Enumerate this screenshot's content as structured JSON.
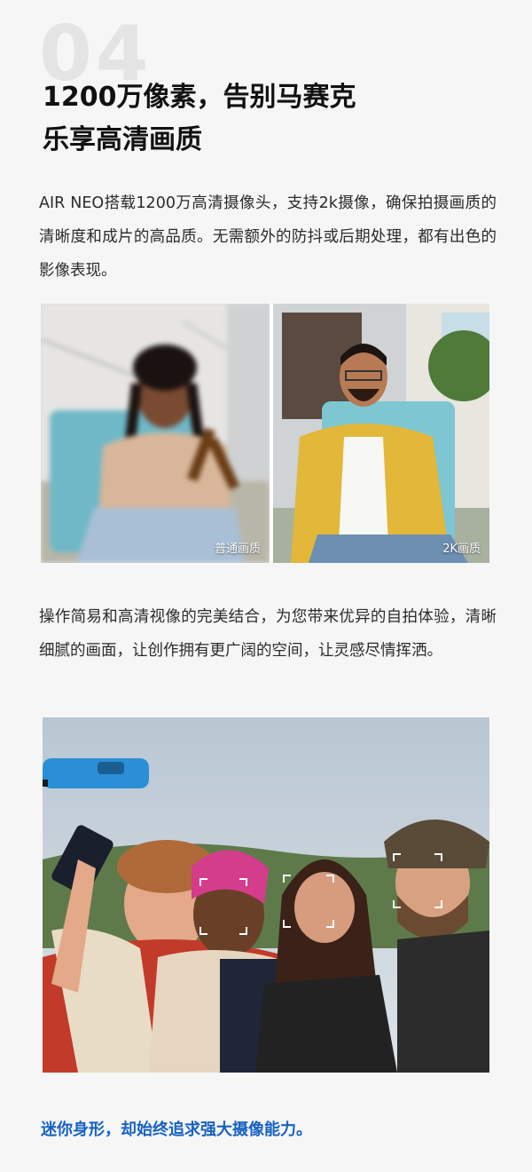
{
  "section_number": "04",
  "heading": {
    "line1": "1200万像素，告别马赛克",
    "line2": "乐享高清画质"
  },
  "paragraph1": "AIR NEO搭载1200万高清摄像头，支持2k摄像，确保拍摄画质的清晰度和成片的高品质。无需额外的防抖或后期处理，都有出色的影像表现。",
  "comparison": {
    "left_label": "普通画质",
    "right_label": "2K画质"
  },
  "paragraph2": "操作简易和高清视像的完美结合，为您带来优异的自拍体验，清晰细腻的画面，让创作拥有更广阔的空间，让灵感尽情挥洒。",
  "tagline": "迷你身形，却始终追求强大摄像能力。",
  "colors": {
    "accent": "#1762c2",
    "drone": "#2a8fd6",
    "background": "#f6f6f6"
  }
}
